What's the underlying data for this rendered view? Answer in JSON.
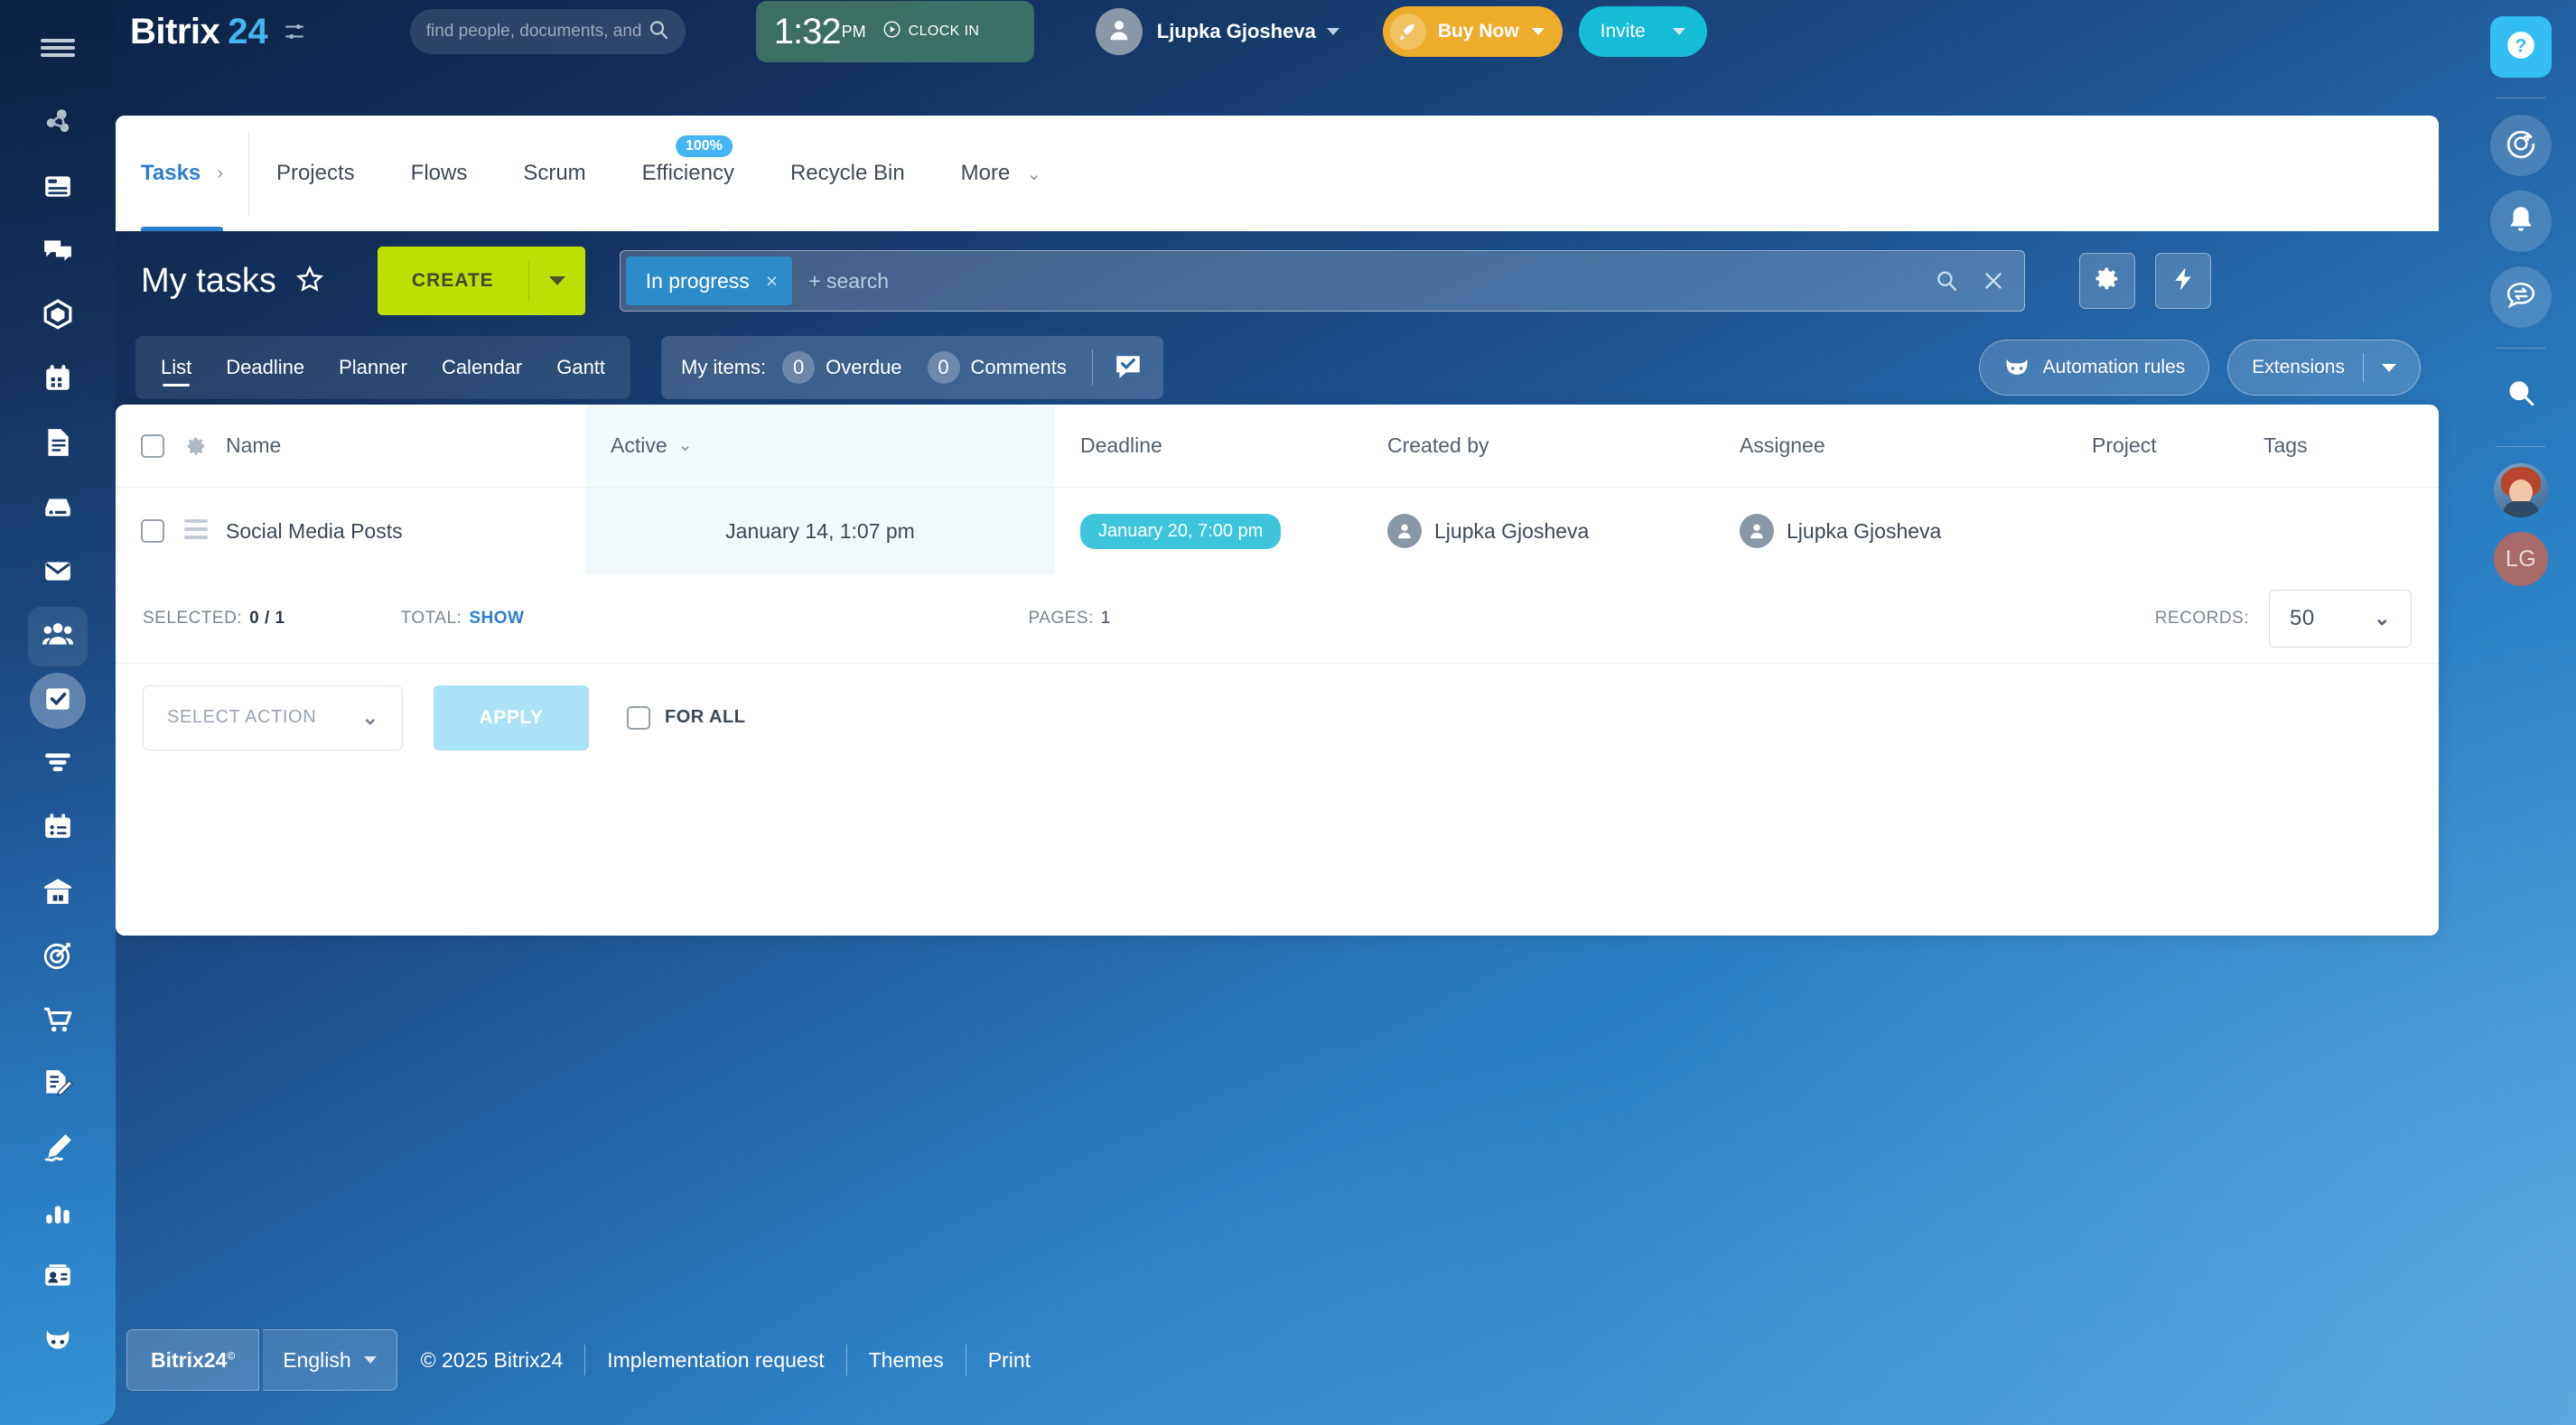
{
  "brand": {
    "name_primary": "Bitrix",
    "name_secondary": "24",
    "accent_blue": "#45b4f0",
    "accent_green": "#bde004",
    "accent_orange": "#edac2c",
    "accent_cyan": "#15bcd8"
  },
  "header": {
    "search_placeholder": "find people, documents, and ...",
    "clock": {
      "time": "1:32",
      "ampm": "PM",
      "action_label": "CLOCK IN"
    },
    "user": {
      "name": "Ljupka Gjosheva"
    },
    "buy_now_label": "Buy Now",
    "invite_label": "Invite"
  },
  "main_tabs": [
    {
      "label": "Tasks",
      "selected": true,
      "chevron": "›"
    },
    {
      "label": "Projects",
      "selected": false
    },
    {
      "label": "Flows",
      "selected": false
    },
    {
      "label": "Scrum",
      "selected": false
    },
    {
      "label": "Efficiency",
      "selected": false,
      "badge": "100%"
    },
    {
      "label": "Recycle Bin",
      "selected": false
    },
    {
      "label": "More",
      "selected": false,
      "chevron": "⌄"
    }
  ],
  "page": {
    "title": "My tasks",
    "create_label": "CREATE",
    "filter": {
      "chip_label": "In progress",
      "chip_remove": "×",
      "search_placeholder": "+ search"
    }
  },
  "view_tabs": [
    {
      "label": "List",
      "selected": true
    },
    {
      "label": "Deadline",
      "selected": false
    },
    {
      "label": "Planner",
      "selected": false
    },
    {
      "label": "Calendar",
      "selected": false
    },
    {
      "label": "Gantt",
      "selected": false
    }
  ],
  "my_items": {
    "label": "My items:",
    "overdue_count": "0",
    "overdue_label": "Overdue",
    "comments_count": "0",
    "comments_label": "Comments"
  },
  "toolbar_right": {
    "automation_label": "Automation rules",
    "extensions_label": "Extensions"
  },
  "table": {
    "columns": [
      "Name",
      "Active",
      "Deadline",
      "Created by",
      "Assignee",
      "Project",
      "Tags"
    ],
    "sort_column": "Active",
    "rows": [
      {
        "name": "Social Media Posts",
        "active": "January 14, 1:07 pm",
        "deadline": "January 20, 7:00 pm",
        "created_by": "Ljupka Gjosheva",
        "assignee": "Ljupka Gjosheva",
        "project": "",
        "tags": ""
      }
    ]
  },
  "status_bar": {
    "selected_label": "SELECTED:",
    "selected_value": "0 / 1",
    "total_label": "TOTAL:",
    "total_link": "SHOW",
    "pages_label": "PAGES:",
    "pages_value": "1",
    "records_label": "RECORDS:",
    "records_value": "50"
  },
  "action_bar": {
    "select_action_label": "SELECT ACTION",
    "apply_label": "APPLY",
    "for_all_label": "FOR ALL"
  },
  "footer": {
    "logo_label": "Bitrix24",
    "logo_sup": "©",
    "language": "English",
    "copyright": "© 2025 Bitrix24",
    "links": [
      "Implementation request",
      "Themes",
      "Print"
    ]
  },
  "left_nav": [
    {
      "icon": "network-icon",
      "label": "Feed"
    },
    {
      "icon": "browser-window-icon",
      "label": "Sites"
    },
    {
      "icon": "chat-bubbles-icon",
      "label": "Messenger"
    },
    {
      "icon": "hexagon-icon",
      "label": "CoPilot"
    },
    {
      "icon": "calendar-icon",
      "label": "Calendar"
    },
    {
      "icon": "document-icon",
      "label": "Docs"
    },
    {
      "icon": "drive-icon",
      "label": "Drive"
    },
    {
      "icon": "mail-icon",
      "label": "Mail"
    },
    {
      "icon": "group-people-icon",
      "label": "Company"
    },
    {
      "icon": "task-check-icon",
      "label": "Tasks",
      "active": true
    },
    {
      "icon": "funnel-icon",
      "label": "CRM"
    },
    {
      "icon": "calendar-list-icon",
      "label": "Booking"
    },
    {
      "icon": "warehouse-icon",
      "label": "Inventory"
    },
    {
      "icon": "target-icon",
      "label": "Marketing"
    },
    {
      "icon": "cart-icon",
      "label": "Online Store"
    },
    {
      "icon": "signature-doc-icon",
      "label": "Sign"
    },
    {
      "icon": "pen-icon",
      "label": "e-Signature"
    },
    {
      "icon": "bar-chart-icon",
      "label": "Analytics"
    },
    {
      "icon": "id-card-icon",
      "label": "Contact Center"
    },
    {
      "icon": "bot-icon",
      "label": "Automation"
    }
  ],
  "right_nav": [
    {
      "icon": "help-question-icon",
      "style": "help"
    },
    {
      "icon": "compass-plus-icon",
      "style": "bubble"
    },
    {
      "icon": "bell-icon",
      "style": "bubble"
    },
    {
      "icon": "chat-transfer-icon",
      "style": "bubble"
    },
    {
      "icon": "search-icon",
      "style": "plain"
    }
  ],
  "right_avatars": {
    "assistant": "assistant-avatar",
    "user_initials": "LG"
  }
}
